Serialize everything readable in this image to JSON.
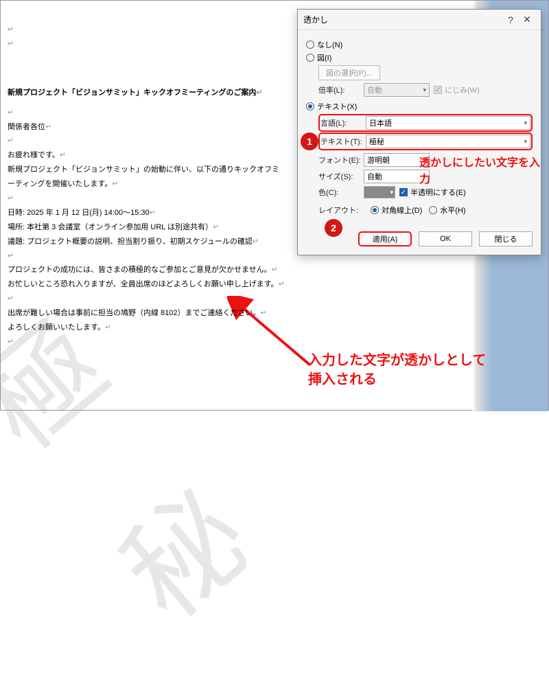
{
  "document": {
    "title": "新規プロジェクト「ビジョンサミット」キックオフミーティングのご案内",
    "lines": [
      "関係者各位",
      "",
      "お疲れ様です。",
      "新規プロジェクト「ビジョンサミット」の始動に伴い、以下の通りキックオフミーティングを開催いたします。",
      "",
      "日時: 2025 年 1 月 12 日(月)  14:00～15:30",
      "場所: 本社第 3 会議室（オンライン参加用 URL は別途共有）",
      "議題: プロジェクト概要の説明、担当割り振り、初期スケジュールの確認",
      "",
      "プロジェクトの成功には、皆さまの積極的なご参加とご意見が欠かせません。",
      "お忙しいところ恐れ入りますが、全員出席のほどよろしくお願い申し上げます。",
      "",
      "出席が難しい場合は事前に担当の鳩野（内線 8102）までご連絡ください。",
      "よろしくお願いいたします。"
    ]
  },
  "watermark_text": "極秘",
  "dialog": {
    "title": "透かし",
    "radio_none": "なし(N)",
    "radio_image": "図(I)",
    "btn_select_image": "図の選択(P)...",
    "label_scale": "倍率(L):",
    "scale_value": "自動",
    "check_blur": "にじみ(W)",
    "radio_text": "テキスト(X)",
    "label_lang": "言語(L):",
    "lang_value": "日本語",
    "label_text": "テキスト(T):",
    "text_value": "極秘",
    "label_font": "フォント(E):",
    "font_value": "游明朝",
    "label_size": "サイズ(S):",
    "size_value": "自動",
    "label_color": "色(C):",
    "check_semi": "半透明にする(E)",
    "label_layout": "レイアウト:",
    "layout_diag": "対角線上(D)",
    "layout_horiz": "水平(H)",
    "btn_apply": "適用(A)",
    "btn_ok": "OK",
    "btn_close": "閉じる"
  },
  "annotations": {
    "badge1": "1",
    "badge2": "2",
    "note1": "透かしにしたい文字を入力",
    "note2_l1": "入力した文字が透かしとして",
    "note2_l2": "挿入される"
  }
}
